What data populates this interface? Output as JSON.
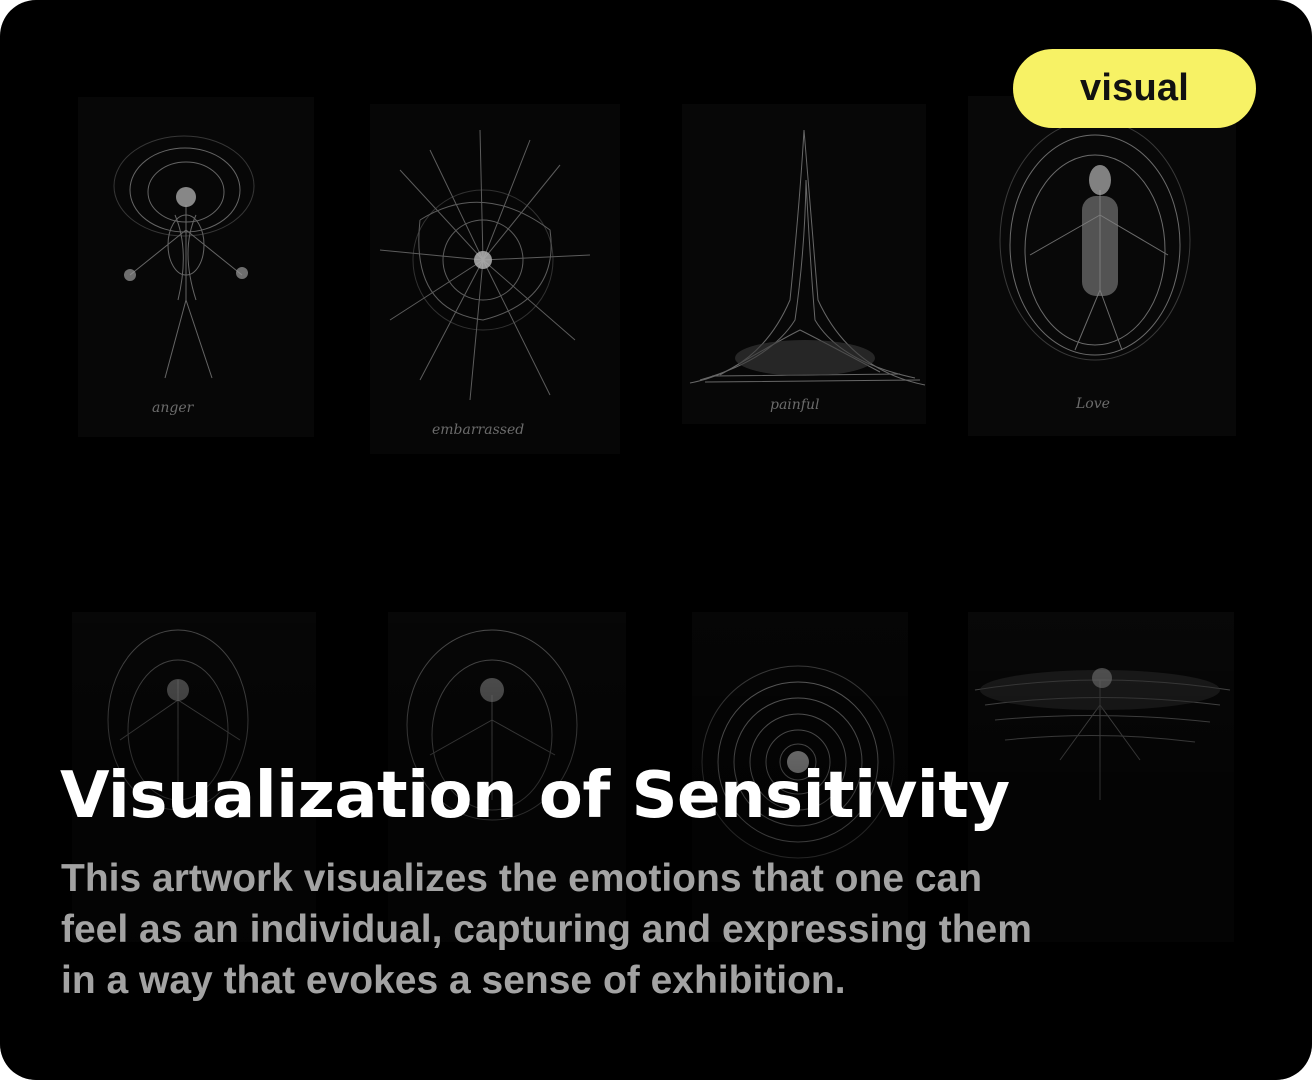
{
  "card": {
    "tag": "visual",
    "title": "Visualization of Sensitivity",
    "description_lines": [
      "This artwork visualizes the emotions that one can",
      "feel as an individual, capturing and expressing them",
      "in a way that evokes a sense of exhibition."
    ]
  },
  "artwork": {
    "top_row": [
      {
        "label": "anger",
        "icon": "scribble-figure-arms-out"
      },
      {
        "label": "embarrassed",
        "icon": "scribble-burst"
      },
      {
        "label": "painful",
        "icon": "scribble-mountain"
      },
      {
        "label": "Love",
        "icon": "scribble-glowing-figure"
      }
    ],
    "bottom_row": [
      {
        "icon": "scribble-figure-faint"
      },
      {
        "icon": "scribble-figure-tangled"
      },
      {
        "icon": "scribble-spiral"
      },
      {
        "icon": "scribble-horizon-figure"
      }
    ]
  },
  "colors": {
    "card_background": "#000000",
    "tag_background": "#f7f265",
    "tag_text": "#111111",
    "title": "#ffffff",
    "description": "#a3a3a3"
  }
}
